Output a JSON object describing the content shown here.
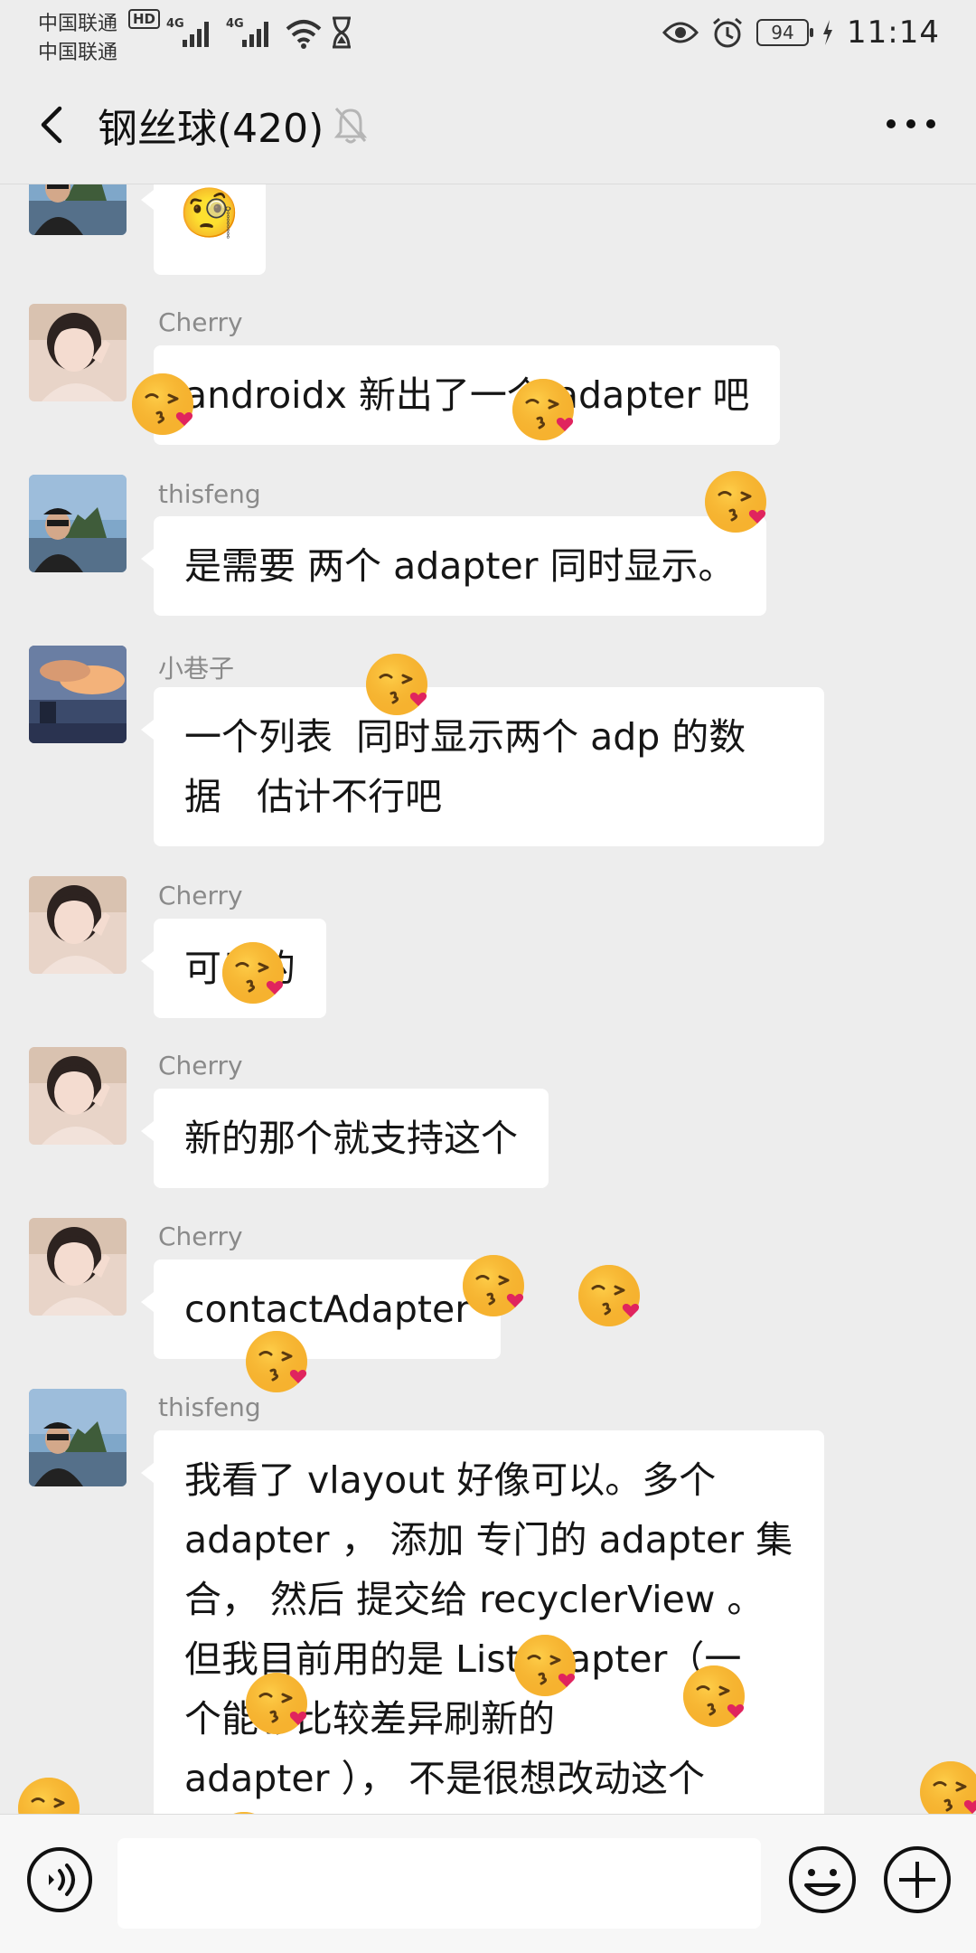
{
  "status_bar": {
    "carrier_1": "中国联通",
    "carrier_2": "中国联通",
    "hd": "HD",
    "network_1": "4G",
    "network_2": "4G",
    "battery": "94",
    "time": "11:14",
    "icons": [
      "signal-icon",
      "wifi-icon",
      "hourglass-icon",
      "eye-icon",
      "alarm-icon",
      "battery-icon",
      "charging-icon"
    ]
  },
  "header": {
    "title": "钢丝球(420)",
    "icons": [
      "back-arrow-icon",
      "mute-bell-icon",
      "more-dots-icon"
    ]
  },
  "messages": [
    {
      "sender": "",
      "text": "",
      "emoji": "🧐",
      "avatar": "avatar-thisfeng"
    },
    {
      "sender": "Cherry",
      "text": "androidx 新出了一个 adapter 吧",
      "avatar": "avatar-cherry"
    },
    {
      "sender": "thisfeng",
      "text": "是需要 两个 adapter 同时显示。",
      "avatar": "avatar-thisfeng"
    },
    {
      "sender": "小巷子",
      "text": "一个列表  同时显示两个 adp 的数\n据   估计不行吧",
      "avatar": "avatar-xiaoxiangzi"
    },
    {
      "sender": "Cherry",
      "text": "可以的",
      "avatar": "avatar-cherry"
    },
    {
      "sender": "Cherry",
      "text": "新的那个就支持这个",
      "avatar": "avatar-cherry"
    },
    {
      "sender": "Cherry",
      "text": "contactAdapter",
      "avatar": "avatar-cherry"
    },
    {
      "sender": "thisfeng",
      "text": "我看了 vlayout 好像可以。多个\nadapter ， 添加 专门的 adapter 集\n合， 然后 提交给 recyclerView 。\n但我目前用的是 ListAdapter（一\n个能够比较差异刷新的\nadapter ）， 不是很想改动这个",
      "avatar": "avatar-thisfeng"
    }
  ],
  "floating_emoji": "😘",
  "input_bar": {
    "placeholder": "",
    "icons": [
      "voice-icon",
      "emoji-icon",
      "plus-icon"
    ]
  },
  "colors": {
    "background": "#ededed",
    "bubble": "#ffffff",
    "sender_name": "#8a8a8a",
    "input_bar": "#f7f7f7"
  }
}
